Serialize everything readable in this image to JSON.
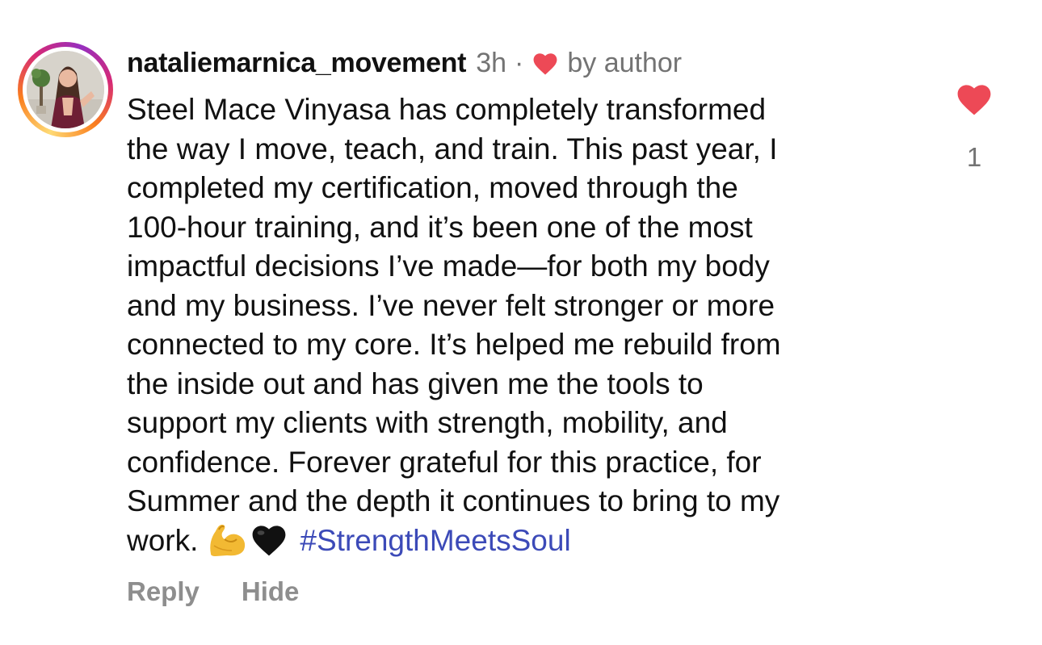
{
  "comment": {
    "username": "nataliemarnica_movement",
    "time": "3h",
    "separator": "·",
    "author_badge": "by author",
    "body_lines": [
      "Steel Mace Vinyasa has completely transformed",
      "the way I move, teach, and train. This past year, I",
      "completed my certification, moved through the",
      "100-hour training, and it’s been one of the most",
      "impactful decisions I’ve made—for both my body",
      "and my business. I’ve never felt stronger or more",
      "connected to my core. It’s helped me rebuild from",
      "the inside out and has given me the tools to",
      "support my clients with strength, mobility, and",
      "confidence. Forever grateful for this practice, for",
      "Summer and the depth it continues to bring to my"
    ],
    "last_line_text": "work.",
    "emojis": [
      "flexed-biceps-emoji",
      "black-heart-emoji"
    ],
    "hashtag": "#StrengthMeetsSoul",
    "actions": {
      "reply_label": "Reply",
      "hide_label": "Hide"
    },
    "like_count": "1"
  },
  "colors": {
    "like_red": "#ed4956",
    "hashtag_blue": "#3c4ab8",
    "muted_gray": "#737373",
    "action_gray": "#8e8e8e",
    "text": "#111111"
  },
  "icons": {
    "avatar": "profile-photo-avatar",
    "author_like": "heart-icon",
    "like_button": "heart-icon"
  }
}
